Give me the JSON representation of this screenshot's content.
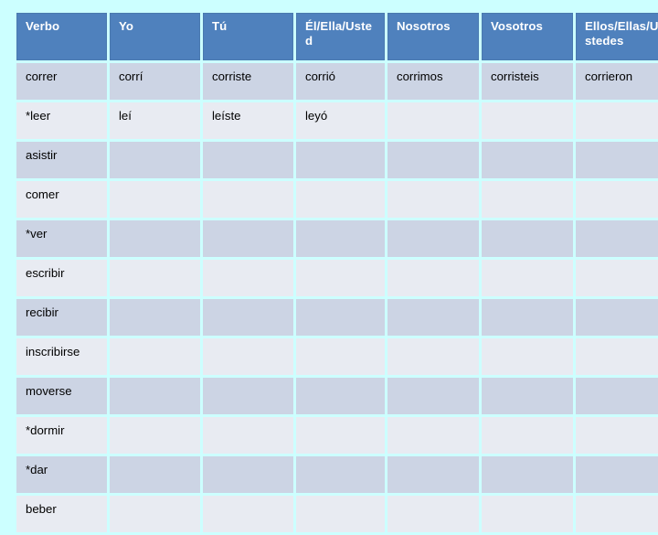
{
  "slide": {
    "background_color": "#ccffff",
    "header_color": "#4f81bd",
    "header_text_color": "#ffffff",
    "row_band_dark_color": "#ccd4e4",
    "row_band_light_color": "#e8ebf2"
  },
  "table": {
    "name": "spanish-preterite-conjugation-table",
    "headers": [
      "Verbo",
      "Yo",
      "Tú",
      "Él/Ella/Usted",
      "Nosotros",
      "Vosotros",
      "Ellos/Ellas/Ustedes"
    ],
    "rows": [
      [
        "correr",
        "corrí",
        "corriste",
        "corrió",
        "corrimos",
        "corristeis",
        "corrieron"
      ],
      [
        "*leer",
        "leí",
        "leíste",
        "leyó",
        "",
        "",
        ""
      ],
      [
        "asistir",
        "",
        "",
        "",
        "",
        "",
        ""
      ],
      [
        "comer",
        "",
        "",
        "",
        "",
        "",
        ""
      ],
      [
        "*ver",
        "",
        "",
        "",
        "",
        "",
        ""
      ],
      [
        "escribir",
        "",
        "",
        "",
        "",
        "",
        ""
      ],
      [
        "recibir",
        "",
        "",
        "",
        "",
        "",
        ""
      ],
      [
        "inscribirse",
        "",
        "",
        "",
        "",
        "",
        ""
      ],
      [
        "moverse",
        "",
        "",
        "",
        "",
        "",
        ""
      ],
      [
        "*dormir",
        "",
        "",
        "",
        "",
        "",
        ""
      ],
      [
        "*dar",
        "",
        "",
        "",
        "",
        "",
        ""
      ],
      [
        "beber",
        "",
        "",
        "",
        "",
        "",
        ""
      ]
    ]
  }
}
